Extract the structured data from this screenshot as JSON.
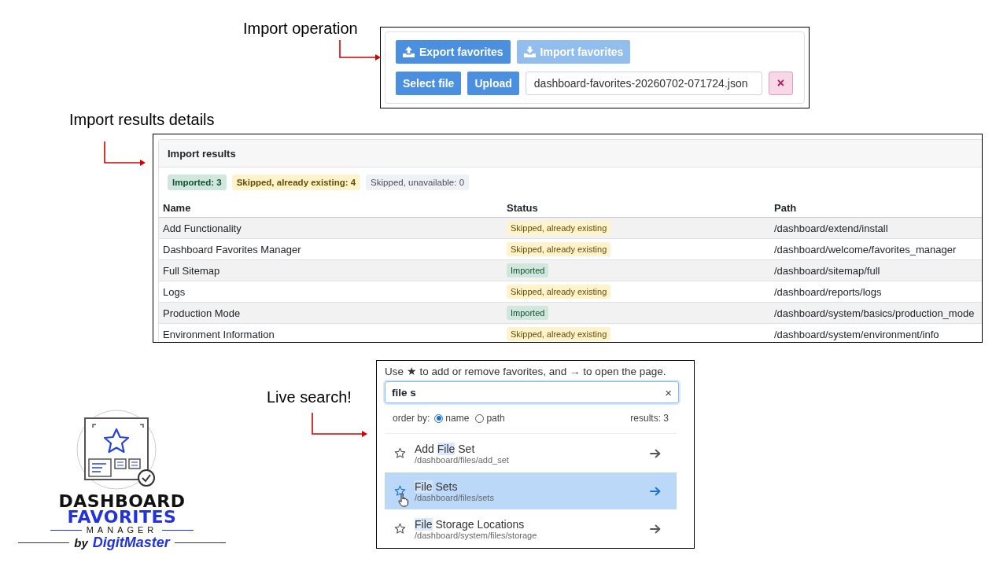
{
  "import_operation": {
    "label": "Import operation",
    "buttons": [
      {
        "label": "Export favorites",
        "kind": "export",
        "disabled": false
      },
      {
        "label": "Import favorites",
        "kind": "import",
        "disabled": true
      }
    ],
    "select_button": "Select file",
    "upload_button": "Upload",
    "file_field": {
      "value": "dashboard-favorites-20260702-071724.json"
    },
    "clear_button": "×"
  },
  "import_results": {
    "label": "Import results details",
    "title": "Import results",
    "summary": [
      {
        "text": "Imported: 3",
        "kind": "success"
      },
      {
        "text": "Skipped, already existing: 4",
        "kind": "warning"
      },
      {
        "text": "Skipped, unavailable: 0",
        "kind": "neutral"
      }
    ],
    "columns": [
      "Name",
      "Status",
      "Path"
    ],
    "rows": [
      {
        "name": "Add Functionality",
        "status": "Skipped, already existing",
        "kind": "warning",
        "path": "/dashboard/extend/install"
      },
      {
        "name": "Dashboard Favorites Manager",
        "status": "Skipped, already existing",
        "kind": "warning",
        "path": "/dashboard/welcome/favorites_manager"
      },
      {
        "name": "Full Sitemap",
        "status": "Imported",
        "kind": "success",
        "path": "/dashboard/sitemap/full"
      },
      {
        "name": "Logs",
        "status": "Skipped, already existing",
        "kind": "warning",
        "path": "/dashboard/reports/logs"
      },
      {
        "name": "Production Mode",
        "status": "Imported",
        "kind": "success",
        "path": "/dashboard/system/basics/production_mode"
      },
      {
        "name": "Environment Information",
        "status": "Skipped, already existing",
        "kind": "warning",
        "path": "/dashboard/system/environment/info"
      }
    ]
  },
  "live_search": {
    "label": "Live search!",
    "hint": "Use ★ to add or remove favorites, and → to open the page.",
    "search_field": {
      "value": "file s"
    },
    "clear_button": "×",
    "order_label": "order by:",
    "order_options": [
      {
        "label": "name",
        "selected": true
      },
      {
        "label": "path",
        "selected": false
      }
    ],
    "results_count": "results: 3",
    "results": [
      {
        "title_parts": [
          {
            "text": "Add ",
            "match": false
          },
          {
            "text": "File",
            "match": true
          },
          {
            "text": " Set",
            "match": false
          }
        ],
        "path": "/dashboard/files/add_set",
        "hovered": false
      },
      {
        "title_parts": [
          {
            "text": "File",
            "match": true
          },
          {
            "text": " Sets",
            "match": false
          }
        ],
        "path": "/dashboard/files/sets",
        "hovered": true
      },
      {
        "title_parts": [
          {
            "text": "File",
            "match": true
          },
          {
            "text": " Storage Locations",
            "match": false
          }
        ],
        "path": "/dashboard/system/files/storage",
        "hovered": false
      }
    ]
  },
  "logo": {
    "line1": "DASHBOARD",
    "line2": "FAVORITES",
    "line3": "MANAGER",
    "by": "by",
    "brand": "DigitMaster"
  }
}
